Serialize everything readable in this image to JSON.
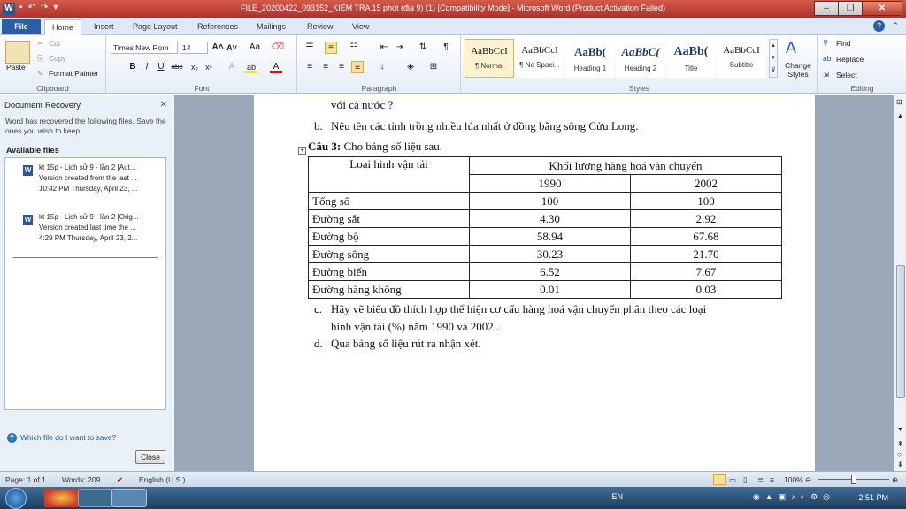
{
  "window": {
    "title": "FILE_20200422_093152_KIỂM TRA 15 phút (địa 9) (1) [Compatibility Mode]  -  Microsoft Word (Product Activation Failed)",
    "minimize": "–",
    "restore": "❐",
    "close": "✕"
  },
  "tabs": {
    "file": "File",
    "items": [
      "Home",
      "Insert",
      "Page Layout",
      "References",
      "Mailings",
      "Review",
      "View"
    ]
  },
  "ribbon": {
    "clipboard": {
      "label": "Clipboard",
      "paste": "Paste",
      "cut": "Cut",
      "copy": "Copy",
      "format_painter": "Format Painter"
    },
    "font": {
      "label": "Font",
      "font_name": "Times New Rom",
      "font_size": "14"
    },
    "paragraph": {
      "label": "Paragraph"
    },
    "styles": {
      "label": "Styles",
      "items": [
        {
          "preview": "AaBbCcI",
          "name": "¶ Normal"
        },
        {
          "preview": "AaBbCcI",
          "name": "¶ No Spaci..."
        },
        {
          "preview": "AaBb(",
          "name": "Heading 1"
        },
        {
          "preview": "AaBbC(",
          "name": "Heading 2"
        },
        {
          "preview": "AaBb(",
          "name": "Title"
        },
        {
          "preview": "AaBbCcI",
          "name": "Subtitle"
        }
      ],
      "change_styles": "Change Styles"
    },
    "editing": {
      "label": "Editing",
      "find": "Find",
      "replace": "Replace",
      "select": "Select"
    }
  },
  "recovery": {
    "title": "Document Recovery",
    "description": "Word has recovered the following files.  Save the ones you wish to keep.",
    "available": "Available files",
    "files": [
      {
        "name": "kt 15p - Lịch sử 9 - lần 2  [Aut...",
        "line2": "Version created from the last ...",
        "line3": "10:42 PM Thursday, April 23, ..."
      },
      {
        "name": "kt 15p - Lịch sử 9 - lần 2  [Orig...",
        "line2": "Version created last time the ...",
        "line3": "4:29 PM Thursday, April 23, 2..."
      }
    ],
    "help": "Which file do I want to save?",
    "close": "Close"
  },
  "document": {
    "line_top": "với cả nước ?",
    "item_b_marker": "b.",
    "item_b": "Nêu tên các tỉnh trồng nhiều lúa nhất ở đồng bằng sông Cửu Long.",
    "cau3_label": "Câu 3:",
    "cau3_text": " Cho bảng số liệu sau.",
    "table": {
      "h_type": "Loại hình vận tải",
      "h_volume": "Khối lượng hàng hoá vận chuyển",
      "years": [
        "1990",
        "2002"
      ],
      "rows": [
        {
          "name": "Tổng số",
          "v1990": "100",
          "v2002": "100"
        },
        {
          "name": "Đường sắt",
          "v1990": "4.30",
          "v2002": "2.92"
        },
        {
          "name": "Đường bộ",
          "v1990": "58.94",
          "v2002": "67.68"
        },
        {
          "name": "Đường sông",
          "v1990": "30.23",
          "v2002": "21.70"
        },
        {
          "name": "Đường biển",
          "v1990": "6.52",
          "v2002": "7.67"
        },
        {
          "name": "Đường hàng không",
          "v1990": "0.01",
          "v2002": "0.03"
        }
      ]
    },
    "item_c_marker": "c.",
    "item_c_line1": "Hãy vẽ biểu đồ thích hợp thể hiện cơ cấu hàng hoá vận chuyển phân theo các loại",
    "item_c_line2": "hình vận tải (%) năm 1990 và 2002..",
    "item_d_marker": "d.",
    "item_d": "Qua bảng số liệu rút ra nhận xét."
  },
  "status": {
    "page": "Page: 1 of 1",
    "words": "Words: 209",
    "language": "English (U.S.)",
    "zoom": "100%"
  },
  "taskbar": {
    "lang": "EN",
    "time": "2:51 PM"
  }
}
